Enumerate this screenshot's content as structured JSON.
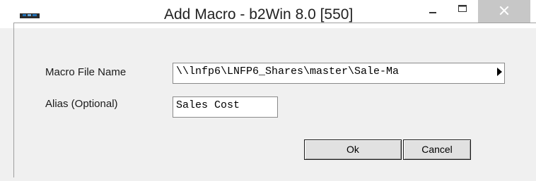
{
  "window": {
    "title": "Add Macro - b2Win 8.0 [550]",
    "controls": {
      "minimize": "minimize-icon",
      "maximize": "maximize-icon",
      "close": "close-icon"
    }
  },
  "form": {
    "macro_file_label": "Macro File Name",
    "macro_file_value": "\\\\lnfp6\\LNFP6_Shares\\master\\Sale-Ma",
    "alias_label": "Alias (Optional)",
    "alias_value": "Sales Cost"
  },
  "buttons": {
    "ok_label": "Ok",
    "cancel_label": "Cancel"
  },
  "colors": {
    "close_button_bg": "#c7c7c7",
    "window_bg": "#f0f0f0",
    "app_icon_accent": "#1f6fb5"
  }
}
